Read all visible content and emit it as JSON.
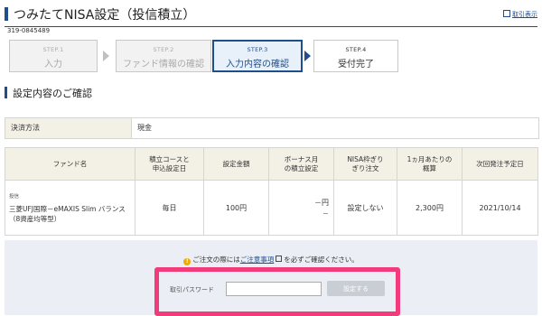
{
  "header": {
    "title": "つみたてNISA設定（投信積立）",
    "print_label": "取引表示"
  },
  "account": {
    "number": "319-0845489"
  },
  "steps": [
    {
      "step": "STEP.1",
      "label": "入力"
    },
    {
      "step": "STEP.2",
      "label": "ファンド情報の確認"
    },
    {
      "step": "STEP.3",
      "label": "入力内容の確認"
    },
    {
      "step": "STEP.4",
      "label": "受付完了"
    }
  ],
  "section": {
    "title": "設定内容のご確認"
  },
  "payment": {
    "label": "決済方法",
    "value": "現金"
  },
  "table": {
    "headers": [
      "ファンド名",
      "積立コースと\n申込設定日",
      "設定金額",
      "ボーナス月\nの積立設定",
      "NISA枠ぎり\nぎり注文",
      "1ヵ月あたりの\n概算",
      "次回発注予定日"
    ],
    "row": {
      "tag": "投信",
      "fund": "三菱UFJ国際－eMAXIS Slim バランス（8資産均等型）",
      "course": "毎日",
      "amount": "100円",
      "bonus": "－円",
      "bonus_sub": "－",
      "nisa": "設定しない",
      "monthly": "2,300円",
      "next_date": "2021/10/14"
    }
  },
  "confirm": {
    "notice_before": "ご注文の際には",
    "notice_link": "ご注意事項",
    "notice_after": "を必ずご確認ください。",
    "password_label": "取引パスワード",
    "password_value": "",
    "submit_label": "設定する"
  },
  "colors": {
    "accent": "#1f4e8c",
    "highlight": "#f23b7a",
    "header_bg": "#f3f0e6"
  }
}
